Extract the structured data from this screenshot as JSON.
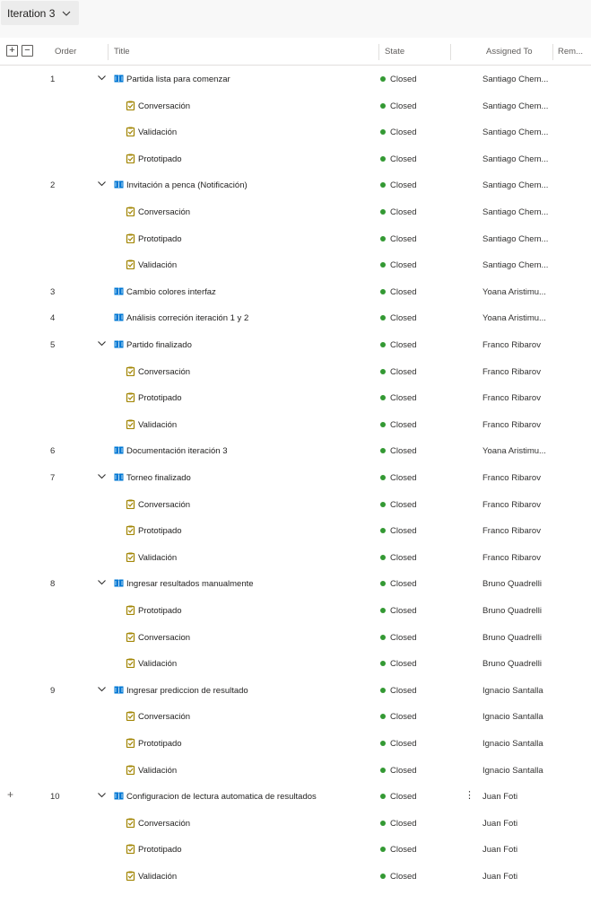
{
  "toolbar": {
    "iteration_label": "Iteration 3"
  },
  "colors": {
    "closed": "#339933",
    "story_icon": "#0078d4",
    "task_icon": "#a4880a"
  },
  "header": {
    "expand_label": "+",
    "collapse_label": "−",
    "order": "Order",
    "title": "Title",
    "state": "State",
    "assigned_to": "Assigned To",
    "remaining": "Rem..."
  },
  "rows": [
    {
      "type": "story",
      "order": "1",
      "title": "Partida lista para comenzar",
      "state": "Closed",
      "assigned": "Santiago Chem..."
    },
    {
      "type": "task",
      "title": "Conversación",
      "state": "Closed",
      "assigned": "Santiago Chem..."
    },
    {
      "type": "task",
      "title": "Validación",
      "state": "Closed",
      "assigned": "Santiago Chem..."
    },
    {
      "type": "task",
      "title": "Prototipado",
      "state": "Closed",
      "assigned": "Santiago Chem..."
    },
    {
      "type": "story",
      "order": "2",
      "title": "Invitación a penca (Notificación)",
      "state": "Closed",
      "assigned": "Santiago Chem..."
    },
    {
      "type": "task",
      "title": "Conversación",
      "state": "Closed",
      "assigned": "Santiago Chem..."
    },
    {
      "type": "task",
      "title": "Prototipado",
      "state": "Closed",
      "assigned": "Santiago Chem..."
    },
    {
      "type": "task",
      "title": "Validación",
      "state": "Closed",
      "assigned": "Santiago Chem..."
    },
    {
      "type": "story-leaf",
      "order": "3",
      "title": "Cambio colores interfaz",
      "state": "Closed",
      "assigned": "Yoana Aristimu..."
    },
    {
      "type": "story-leaf",
      "order": "4",
      "title": "Análisis correción iteración 1 y 2",
      "state": "Closed",
      "assigned": "Yoana Aristimu..."
    },
    {
      "type": "story",
      "order": "5",
      "title": "Partido finalizado",
      "state": "Closed",
      "assigned": "Franco Ribarov"
    },
    {
      "type": "task",
      "title": "Conversación",
      "state": "Closed",
      "assigned": "Franco Ribarov"
    },
    {
      "type": "task",
      "title": "Prototipado",
      "state": "Closed",
      "assigned": "Franco Ribarov"
    },
    {
      "type": "task",
      "title": "Validación",
      "state": "Closed",
      "assigned": "Franco Ribarov"
    },
    {
      "type": "story-leaf",
      "order": "6",
      "title": "Documentación iteración 3",
      "state": "Closed",
      "assigned": "Yoana Aristimu..."
    },
    {
      "type": "story",
      "order": "7",
      "title": "Torneo finalizado",
      "state": "Closed",
      "assigned": "Franco Ribarov"
    },
    {
      "type": "task",
      "title": "Conversación",
      "state": "Closed",
      "assigned": "Franco Ribarov"
    },
    {
      "type": "task",
      "title": "Prototipado",
      "state": "Closed",
      "assigned": "Franco Ribarov"
    },
    {
      "type": "task",
      "title": "Validación",
      "state": "Closed",
      "assigned": "Franco Ribarov"
    },
    {
      "type": "story",
      "order": "8",
      "title": "Ingresar resultados manualmente",
      "state": "Closed",
      "assigned": "Bruno Quadrelli"
    },
    {
      "type": "task",
      "title": "Prototipado",
      "state": "Closed",
      "assigned": "Bruno Quadrelli"
    },
    {
      "type": "task",
      "title": "Conversacion",
      "state": "Closed",
      "assigned": "Bruno Quadrelli"
    },
    {
      "type": "task",
      "title": "Validación",
      "state": "Closed",
      "assigned": "Bruno Quadrelli"
    },
    {
      "type": "story",
      "order": "9",
      "title": "Ingresar prediccion de resultado",
      "state": "Closed",
      "assigned": "Ignacio Santalla"
    },
    {
      "type": "task",
      "title": "Conversación",
      "state": "Closed",
      "assigned": "Ignacio Santalla"
    },
    {
      "type": "task",
      "title": "Prototipado",
      "state": "Closed",
      "assigned": "Ignacio Santalla"
    },
    {
      "type": "task",
      "title": "Validación",
      "state": "Closed",
      "assigned": "Ignacio Santalla"
    },
    {
      "type": "story",
      "order": "10",
      "title": "Configuracion de lectura automatica de resultados",
      "state": "Closed",
      "assigned": "Juan Foti",
      "hover": true,
      "add_label": "+",
      "more_label": "⋮"
    },
    {
      "type": "task",
      "title": "Conversación",
      "state": "Closed",
      "assigned": "Juan Foti"
    },
    {
      "type": "task",
      "title": "Prototipado",
      "state": "Closed",
      "assigned": "Juan Foti"
    },
    {
      "type": "task",
      "title": "Validación",
      "state": "Closed",
      "assigned": "Juan Foti"
    }
  ]
}
